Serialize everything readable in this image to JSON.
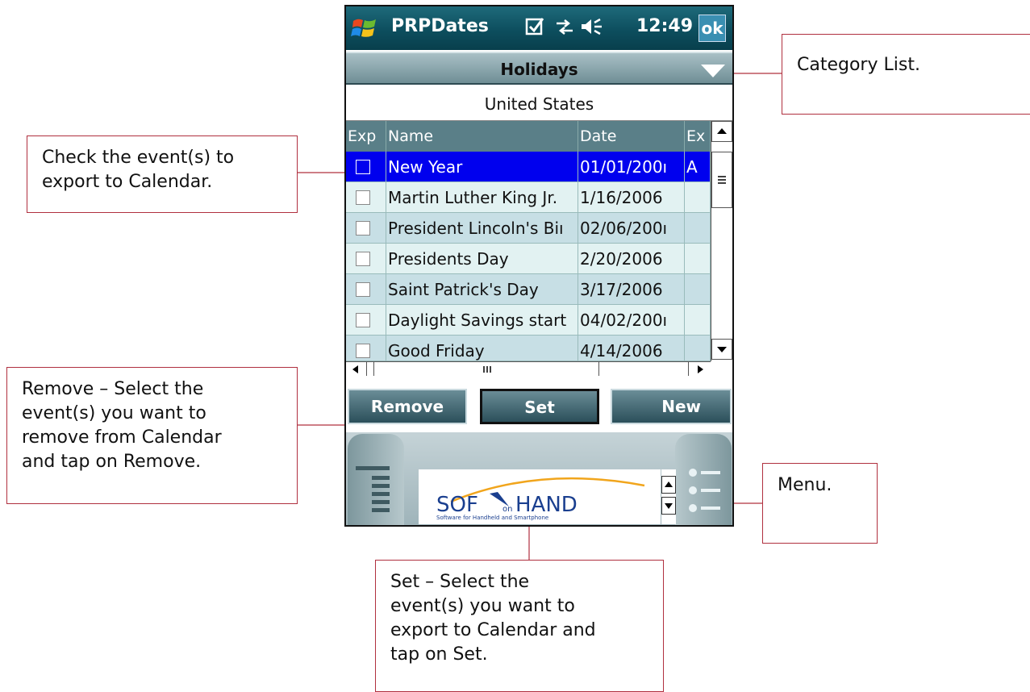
{
  "titlebar": {
    "app_title": "PRPDates",
    "time": "12:49",
    "ok_label": "ok"
  },
  "category": {
    "selected": "Holidays"
  },
  "country": "United States",
  "grid": {
    "columns": [
      "Exp",
      "Name",
      "Date",
      "Ex"
    ],
    "rows": [
      {
        "name": "New Year",
        "date": "01/01/200ı",
        "ex": "A"
      },
      {
        "name": "Martin Luther King Jr.",
        "date": "1/16/2006",
        "ex": ""
      },
      {
        "name": "President Lincoln's Biı",
        "date": "02/06/200ı",
        "ex": ""
      },
      {
        "name": "Presidents Day",
        "date": "2/20/2006",
        "ex": ""
      },
      {
        "name": "Saint Patrick's Day",
        "date": "3/17/2006",
        "ex": ""
      },
      {
        "name": "Daylight Savings start",
        "date": "04/02/200ı",
        "ex": ""
      },
      {
        "name": "Good Friday",
        "date": "4/14/2006",
        "ex": ""
      }
    ]
  },
  "buttons": {
    "remove": "Remove",
    "set": "Set",
    "new": "New"
  },
  "ad": {
    "brand": "SOFTonHAND",
    "tagline": "Software for Handheld and Smartphone"
  },
  "callouts": {
    "category": "Category List.",
    "check": [
      "Check the event(s) to",
      "export to Calendar."
    ],
    "remove": [
      "Remove – Select the",
      "event(s) you want to",
      "remove from Calendar",
      "and tap on Remove."
    ],
    "menu": "Menu.",
    "set": [
      "Set – Select the",
      "event(s) you want to",
      "export to Calendar and",
      "tap on Set."
    ]
  },
  "colors": {
    "titlebar": "#0d4e5e",
    "selection": "#0000ee",
    "callout_border": "#b0303f"
  }
}
